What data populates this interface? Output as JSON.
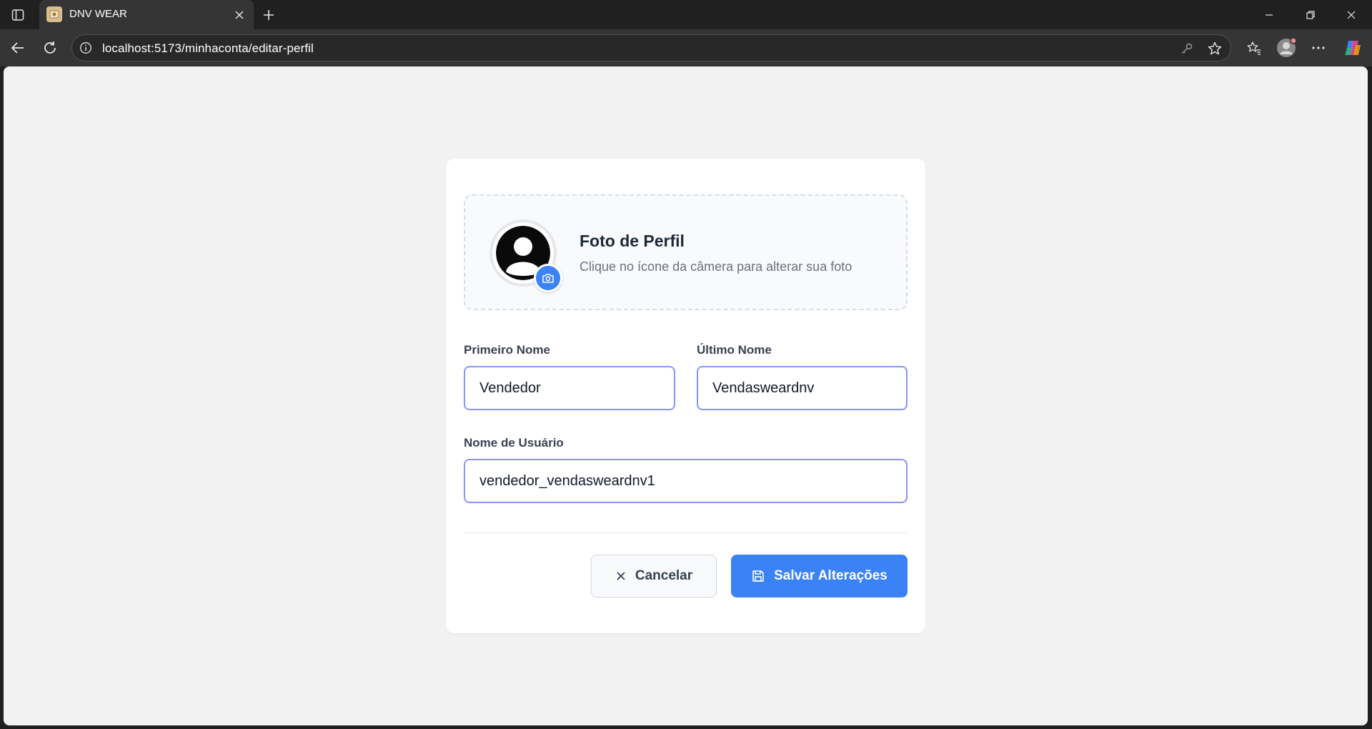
{
  "browser": {
    "tab_title": "DNV WEAR",
    "url": "localhost:5173/minhaconta/editar-perfil"
  },
  "profile_photo": {
    "title": "Foto de Perfil",
    "subtitle": "Clique no ícone da câmera para alterar sua foto"
  },
  "form": {
    "first_name": {
      "label": "Primeiro Nome",
      "value": "Vendedor"
    },
    "last_name": {
      "label": "Último Nome",
      "value": "Vendasweardnv"
    },
    "username": {
      "label": "Nome de Usuário",
      "value": "vendedor_vendasweardnv1"
    }
  },
  "actions": {
    "cancel_label": "Cancelar",
    "save_label": "Salvar Alterações"
  },
  "colors": {
    "accent": "#3b82f6",
    "input_border": "#8b93f7",
    "page_background": "#f2f2f2",
    "browser_chrome": "#202020"
  },
  "icons": {
    "camera": "camera-icon",
    "cancel": "close-icon",
    "save": "save-icon",
    "avatar": "user-avatar-icon"
  }
}
